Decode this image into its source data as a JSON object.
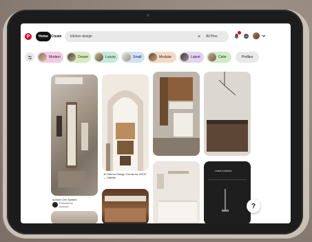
{
  "nav": {
    "logo": "P",
    "home_label": "Home",
    "create_label": "Create"
  },
  "search": {
    "query": "kitchen design",
    "filter_label": "All Pins"
  },
  "chips": [
    {
      "label": "Modern",
      "color": "#f4c9e6"
    },
    {
      "label": "Dream",
      "color": "#d9ebbd"
    },
    {
      "label": "Luxury",
      "color": "#c5ead9"
    },
    {
      "label": "Small",
      "color": "#cfe3f5"
    },
    {
      "label": "Modular",
      "color": "#f4d9c4"
    },
    {
      "label": "Latest",
      "color": "#e2d4f2"
    },
    {
      "label": "Color",
      "color": "#cdeec4"
    }
  ],
  "profiles_label": "Profiles",
  "pins": {
    "tall_title": "Archive Ore System",
    "tall_sub": "Promoted by",
    "tall_by": "ArchInno",
    "arch_title": "10 Interior Design Trends for 2023! — Sabelle",
    "arch_more": "···",
    "dark_tile_caption": "Leave a kitchen"
  },
  "help_label": "?"
}
